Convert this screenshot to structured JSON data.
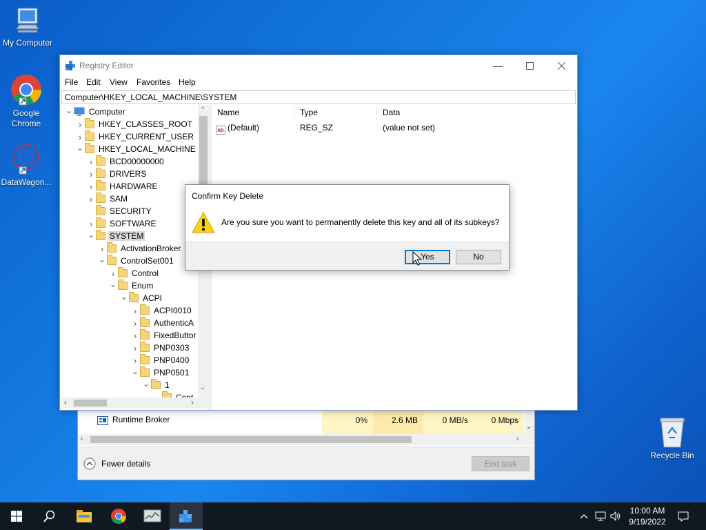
{
  "desktop": {
    "icons": [
      {
        "label": "My Computer"
      },
      {
        "label": "Google Chrome"
      },
      {
        "label": "DataWagon..."
      },
      {
        "label": "Recycle Bin"
      }
    ]
  },
  "taskmanager": {
    "process_name": "Runtime Broker",
    "cpu": "0%",
    "memory": "2.6 MB",
    "disk": "0 MB/s",
    "network": "0 Mbps",
    "fewer_details": "Fewer details",
    "end_task": "End task"
  },
  "regedit": {
    "title": "Registry Editor",
    "menu": {
      "file": "File",
      "edit": "Edit",
      "view": "View",
      "favorites": "Favorites",
      "help": "Help"
    },
    "address": "Computer\\HKEY_LOCAL_MACHINE\\SYSTEM",
    "tree": [
      {
        "label": "Computer",
        "chev": "v"
      },
      {
        "label": "HKEY_CLASSES_ROOT",
        "chev": ">"
      },
      {
        "label": "HKEY_CURRENT_USER",
        "chev": ">"
      },
      {
        "label": "HKEY_LOCAL_MACHINE",
        "chev": "v"
      },
      {
        "label": "BCD00000000",
        "chev": ">"
      },
      {
        "label": "DRIVERS",
        "chev": ">"
      },
      {
        "label": "HARDWARE",
        "chev": ">"
      },
      {
        "label": "SAM",
        "chev": ">"
      },
      {
        "label": "SECURITY",
        "chev": ""
      },
      {
        "label": "SOFTWARE",
        "chev": ">"
      },
      {
        "label": "SYSTEM",
        "chev": "v"
      },
      {
        "label": "ActivationBroker",
        "chev": ">"
      },
      {
        "label": "ControlSet001",
        "chev": "v"
      },
      {
        "label": "Control",
        "chev": ">"
      },
      {
        "label": "Enum",
        "chev": "v"
      },
      {
        "label": "ACPI",
        "chev": "v"
      },
      {
        "label": "ACPI0010",
        "chev": ">"
      },
      {
        "label": "AuthenticA",
        "chev": ">"
      },
      {
        "label": "FixedButtor",
        "chev": ">"
      },
      {
        "label": "PNP0303",
        "chev": ">"
      },
      {
        "label": "PNP0400",
        "chev": ">"
      },
      {
        "label": "PNP0501",
        "chev": "v"
      },
      {
        "label": "1",
        "chev": "v"
      },
      {
        "label": "Cont",
        "chev": ""
      }
    ],
    "columns": {
      "name": "Name",
      "type": "Type",
      "data": "Data"
    },
    "values": [
      {
        "name": "(Default)",
        "type": "REG_SZ",
        "data": "(value not set)"
      }
    ]
  },
  "dialog": {
    "title": "Confirm Key Delete",
    "message": "Are you sure you want to permanently delete this key and all of its subkeys?",
    "yes": "Yes",
    "no": "No"
  },
  "taskbar": {
    "time": "10:00 AM",
    "date": "9/19/2022"
  },
  "colors": {
    "accent": "#0078d7",
    "taskbar": "#101820"
  }
}
